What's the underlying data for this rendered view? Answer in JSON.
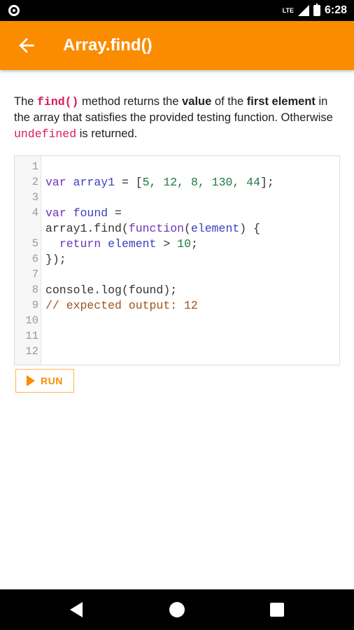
{
  "status": {
    "network": "LTE",
    "time": "6:28"
  },
  "app_bar": {
    "title": "Array.find()",
    "accent": "#fb8c00"
  },
  "description": {
    "t1": "The ",
    "method": "find()",
    "t2": " method returns the ",
    "value": "value",
    "t3": " of the ",
    "first": "first element",
    "t4": " in the array that satisfies the provided testing function. Otherwise ",
    "undefined": "undefined",
    "t5": " is returned."
  },
  "editor": {
    "line_numbers": [
      "1",
      "2",
      "3",
      "4",
      "5",
      "6",
      "7",
      "8",
      "9",
      "10",
      "11",
      "12"
    ],
    "lines": [
      {
        "kw": "",
        "rest": ""
      },
      {
        "kw": "var",
        "var": "array1",
        "mid": " = [",
        "nums": "5, 12, 8, 130, 44",
        "end": "];"
      },
      {
        "kw": "",
        "rest": ""
      },
      {
        "kw": "var",
        "var": "found",
        "end": " ="
      },
      {
        "wrap": "array1.find(",
        "fn": "function",
        "p1": "(",
        "arg": "element",
        "p2": ") {"
      },
      {
        "kw": "return",
        "var": "element",
        "mid": " > ",
        "nums": "10",
        "end": ";"
      },
      {
        "rest": "});"
      },
      {
        "rest": ""
      },
      {
        "rest": "console.log(found);"
      },
      {
        "comment": "// expected output: 12"
      },
      {
        "rest": ""
      },
      {
        "rest": ""
      },
      {
        "rest": ""
      }
    ]
  },
  "run_button": {
    "label": "RUN"
  }
}
